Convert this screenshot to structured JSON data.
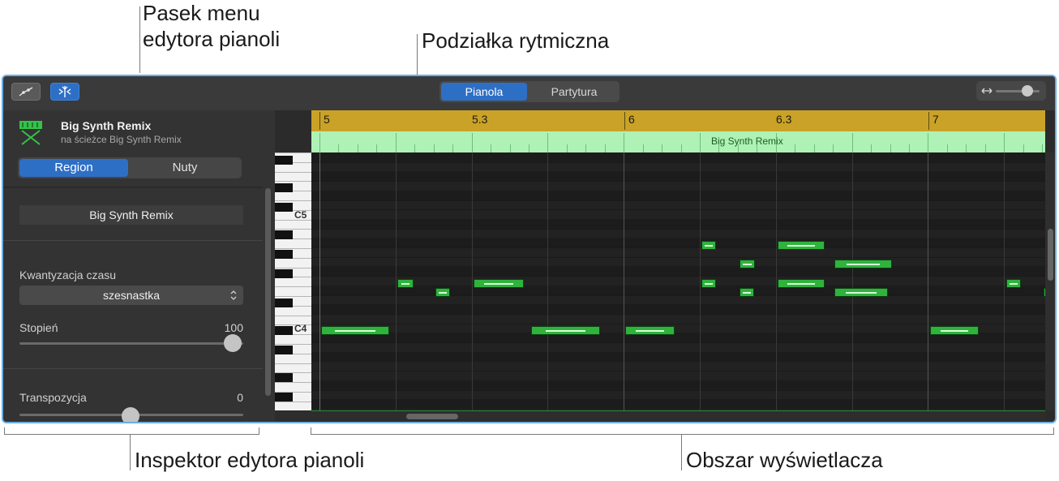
{
  "callouts": {
    "menu_bar_line1": "Pasek menu",
    "menu_bar_line2": "edytora pianoli",
    "ruler": "Podziałka rytmiczna",
    "inspector": "Inspektor edytora pianoli",
    "display": "Obszar wyświetlacza"
  },
  "toolbar": {
    "automation_icon": "automation-curve-icon",
    "snap_icon": "catch-playhead-icon",
    "view_tabs": [
      {
        "label": "Pianola",
        "selected": true
      },
      {
        "label": "Partytura",
        "selected": false
      }
    ],
    "zoom_icon": "horizontal-zoom-icon",
    "zoom_value": 0.7
  },
  "inspector": {
    "track_name": "Big Synth Remix",
    "track_sub": "na ścieżce Big Synth Remix",
    "track_icon": "synth-keyboard-icon",
    "tabs": [
      {
        "label": "Region",
        "selected": true
      },
      {
        "label": "Nuty",
        "selected": false
      }
    ],
    "region_name": "Big Synth Remix",
    "quantize_label": "Kwantyzacja czasu",
    "quantize_value": "szesnastka",
    "strength_label": "Stopień",
    "strength_value": "100",
    "strength_fraction": 1.0,
    "transpose_label": "Transpozycja",
    "transpose_value": "0",
    "transpose_fraction": 0.5
  },
  "ruler": {
    "labels": [
      "5",
      "5.3",
      "6",
      "6.3",
      "7"
    ],
    "color": "#c9a227"
  },
  "region": {
    "name": "Big Synth Remix",
    "color": "#aef2b6"
  },
  "keys": {
    "labels": [
      "C5",
      "C4"
    ]
  },
  "note_color": "#2fb33d"
}
